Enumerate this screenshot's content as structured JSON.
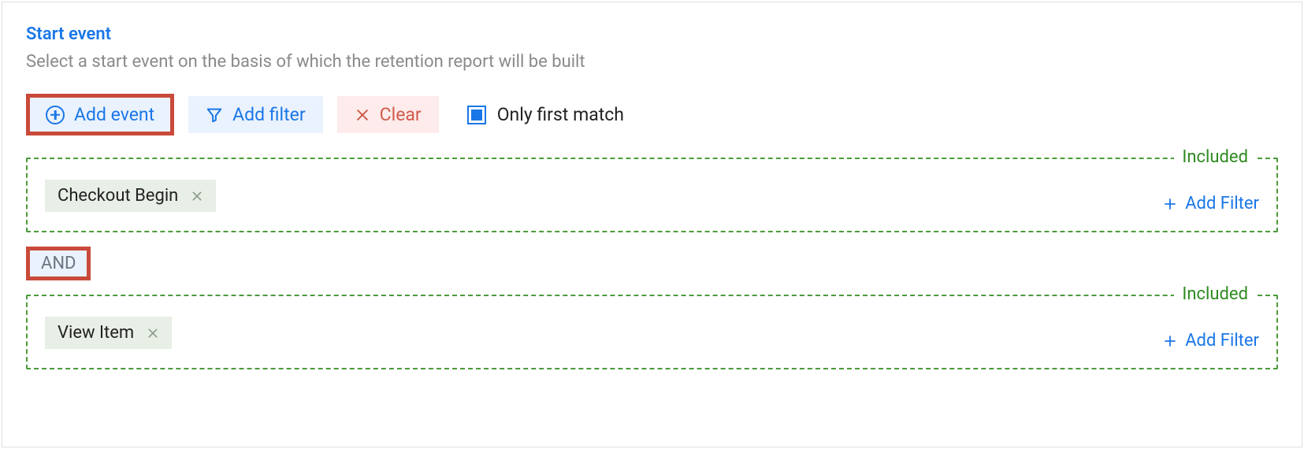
{
  "header": {
    "title": "Start event",
    "subtitle": "Select a start event on the basis of which the retention report will be built"
  },
  "toolbar": {
    "add_event_label": "Add event",
    "add_filter_label": "Add filter",
    "clear_label": "Clear",
    "only_first_match_label": "Only first match",
    "only_first_match_checked": true
  },
  "operator_label": "AND",
  "groups": [
    {
      "legend": "Included",
      "chip": "Checkout Begin",
      "add_filter_label": "Add Filter"
    },
    {
      "legend": "Included",
      "chip": "View Item",
      "add_filter_label": "Add Filter"
    }
  ]
}
